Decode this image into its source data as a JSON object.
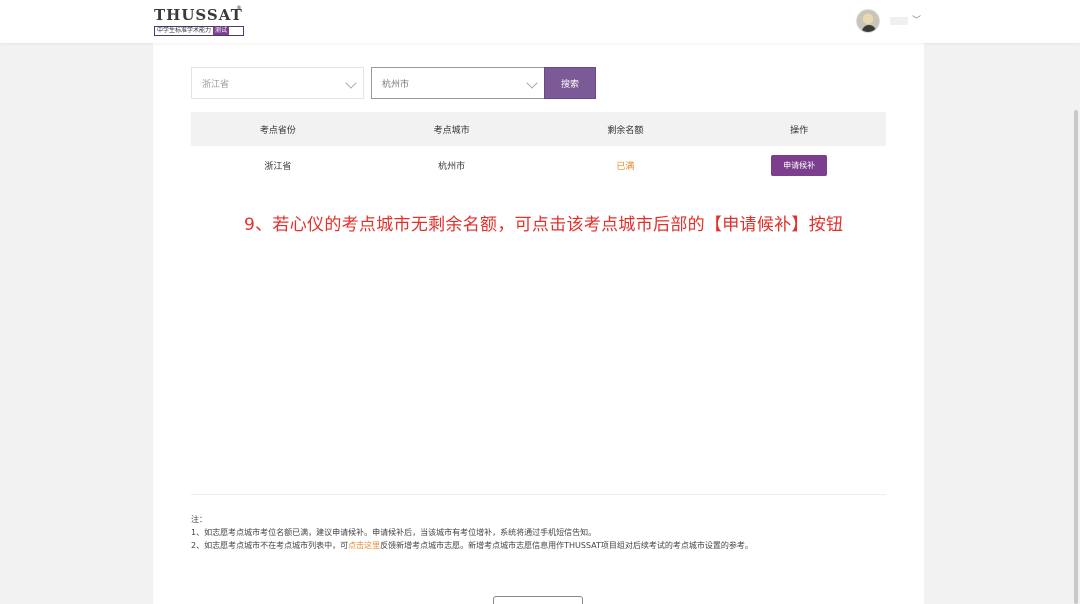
{
  "header": {
    "logo_title": "THUSSAT",
    "logo_reg": "®",
    "logo_subtitle": "中学生标准学术能力",
    "logo_tag": "测试",
    "chevron": "﹀"
  },
  "filters": {
    "province": "浙江省",
    "city": "杭州市",
    "search_label": "搜索"
  },
  "table": {
    "headers": [
      "考点省份",
      "考点城市",
      "剩余名额",
      "操作"
    ],
    "rows": [
      {
        "province": "浙江省",
        "city": "杭州市",
        "remaining": "已满",
        "action": "申请候补"
      }
    ]
  },
  "annotation": "9、若心仪的考点城市无剩余名额，可点击该考点城市后部的【申请候补】按钮",
  "notes": {
    "title": "注：",
    "line1": "1、如志愿考点城市考位名额已满，建议申请候补。申请候补后，当该城市有考位增补，系统将通过手机短信告知。",
    "line2_before": "2、如志愿考点城市不在考点城市列表中，可",
    "line2_link": "点击这里",
    "line2_after": "反馈新增考点城市志愿。新增考点城市志愿信息用作THUSSAT项目组对后续考试的考点城市设置的参考。"
  },
  "colors": {
    "accent": "#7b3f8e",
    "warning": "#e58a2a",
    "annotation": "#e2302b"
  }
}
